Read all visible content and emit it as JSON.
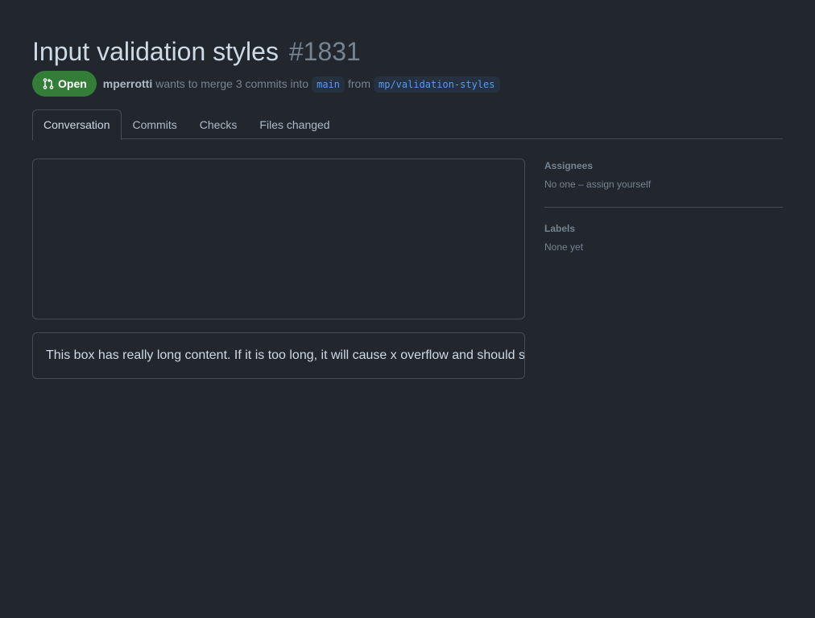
{
  "pr": {
    "title": "Input validation styles",
    "number": "#1831",
    "state": "Open",
    "author": "mperrotti",
    "merge_text": "wants to merge 3 commits into",
    "base_branch": "main",
    "from_text": "from",
    "head_branch": "mp/validation-styles"
  },
  "tabs": [
    {
      "label": "Conversation",
      "selected": true
    },
    {
      "label": "Commits",
      "selected": false
    },
    {
      "label": "Checks",
      "selected": false
    },
    {
      "label": "Files changed",
      "selected": false
    }
  ],
  "main": {
    "long_box_text": "This box has really long content. If it is too long, it will cause x overflow and should s"
  },
  "sidebar": {
    "assignees": {
      "heading": "Assignees",
      "value": "No one – assign yourself"
    },
    "labels": {
      "heading": "Labels",
      "value": "None yet"
    }
  },
  "colors": {
    "background": "#22272e",
    "open_badge": "#347d39",
    "branch_text": "#539bf5",
    "border": "#444c56"
  },
  "icons": {
    "state": "git-pull-request-icon"
  }
}
